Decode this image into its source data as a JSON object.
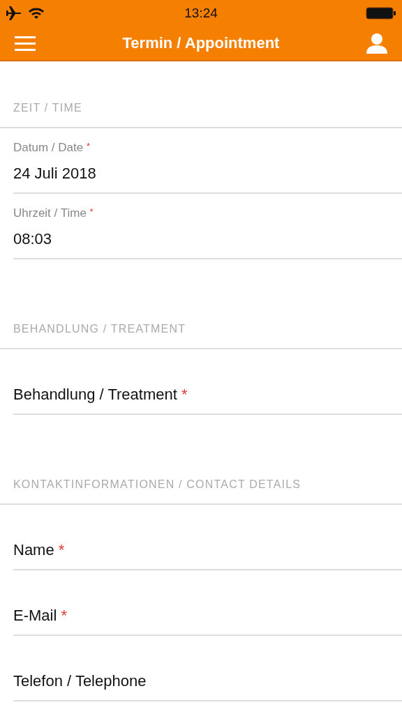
{
  "status_bar": {
    "time": "13:24"
  },
  "nav_bar": {
    "title": "Termin / Appointment"
  },
  "sections": [
    {
      "title": "ZEIT / TIME",
      "fields": [
        {
          "kind": "filled",
          "label": "Datum / Date",
          "required_mark": "*",
          "value": "24 Juli 2018"
        },
        {
          "kind": "filled",
          "label": "Uhrzeit / Time",
          "required_mark": "*",
          "value": "08:03"
        }
      ]
    },
    {
      "title": "BEHANDLUNG / TREATMENT",
      "fields": [
        {
          "kind": "empty",
          "placeholder": "Behandlung / Treatment",
          "required_mark": "*"
        }
      ]
    },
    {
      "title": "KONTAKTINFORMATIONEN / CONTACT DETAILS",
      "fields": [
        {
          "kind": "empty",
          "placeholder": "Name",
          "required_mark": "*"
        },
        {
          "kind": "empty",
          "placeholder": "E-Mail",
          "required_mark": "*"
        },
        {
          "kind": "empty",
          "placeholder": "Telefon / Telephone"
        }
      ]
    }
  ]
}
